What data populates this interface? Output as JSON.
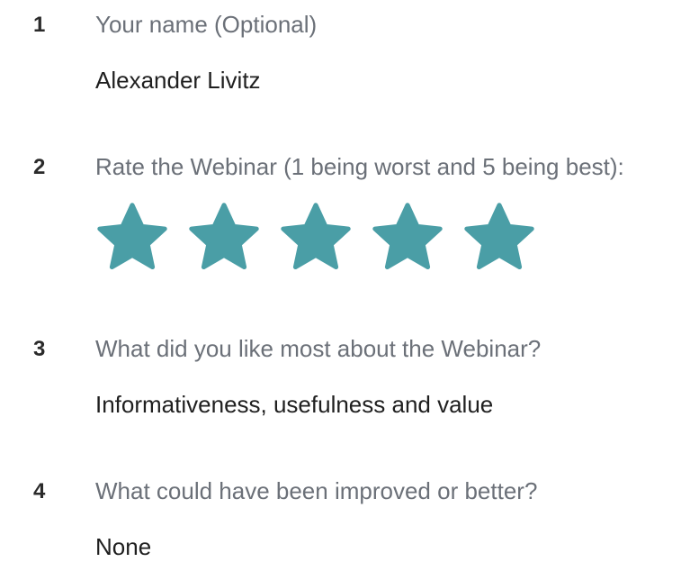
{
  "questions": [
    {
      "number": "1",
      "text": "Your name (Optional)",
      "answer": "Alexander Livitz"
    },
    {
      "number": "2",
      "text": "Rate the Webinar (1 being worst and 5 being best):",
      "rating": 5,
      "rating_max": 5,
      "star_color": "#4a9ea6"
    },
    {
      "number": "3",
      "text": "What did you like most about the Webinar?",
      "answer": "Informativeness, usefulness and value"
    },
    {
      "number": "4",
      "text": "What could have been improved or better?",
      "answer": "None"
    }
  ]
}
